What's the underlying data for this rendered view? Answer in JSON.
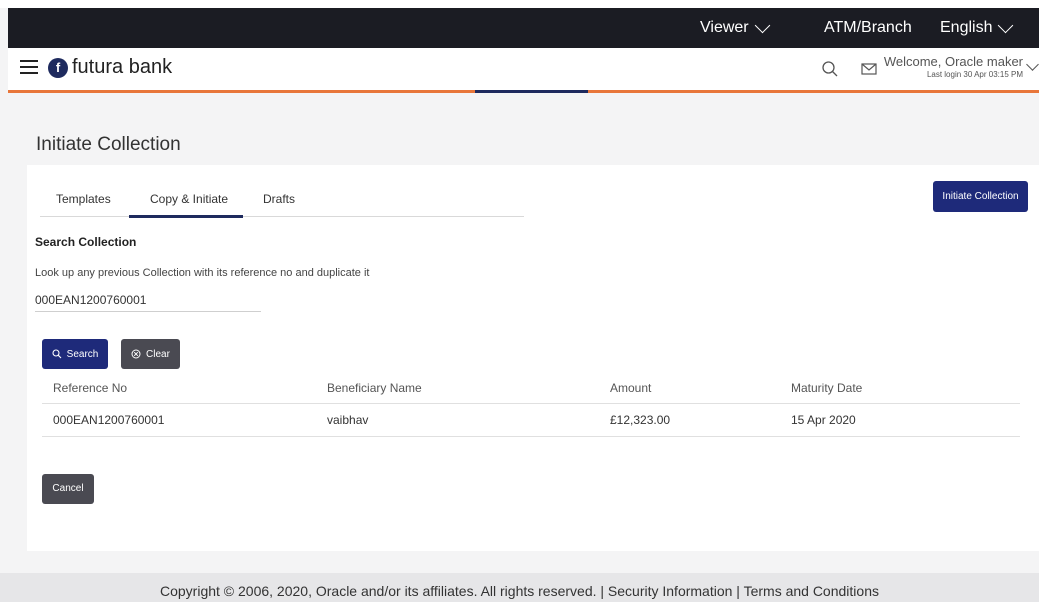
{
  "topnav": {
    "viewer": "Viewer",
    "atm_branch": "ATM/Branch",
    "language": "English"
  },
  "header": {
    "brand": "futura bank",
    "welcome": "Welcome, Oracle maker",
    "last_login": "Last login 30 Apr 03:15 PM"
  },
  "page": {
    "title": "Initiate Collection",
    "tabs": [
      "Templates",
      "Copy & Initiate",
      "Drafts"
    ],
    "active_tab": "Copy & Initiate",
    "initiate_button": "Initiate Collection",
    "section_heading": "Search Collection",
    "helper_text": "Look up any previous Collection with its reference no and duplicate it",
    "reference_value": "000EAN1200760001",
    "search_button": "Search",
    "clear_button": "Clear",
    "cancel_button": "Cancel"
  },
  "table": {
    "columns": [
      "Reference No",
      "Beneficiary Name",
      "Amount",
      "Maturity Date"
    ],
    "rows": [
      {
        "reference": "000EAN1200760001",
        "beneficiary": "vaibhav",
        "amount": "£12,323.00",
        "maturity": "15 Apr 2020"
      }
    ]
  },
  "footer": {
    "text": "Copyright © 2006, 2020, Oracle and/or its affiliates. All rights reserved. | Security Information | Terms and Conditions"
  },
  "colors": {
    "brand_navy": "#1e2a7a",
    "accent_orange": "#e8763a",
    "nav_dark": "#1b1c23",
    "link_blue": "#3b6fb6"
  }
}
